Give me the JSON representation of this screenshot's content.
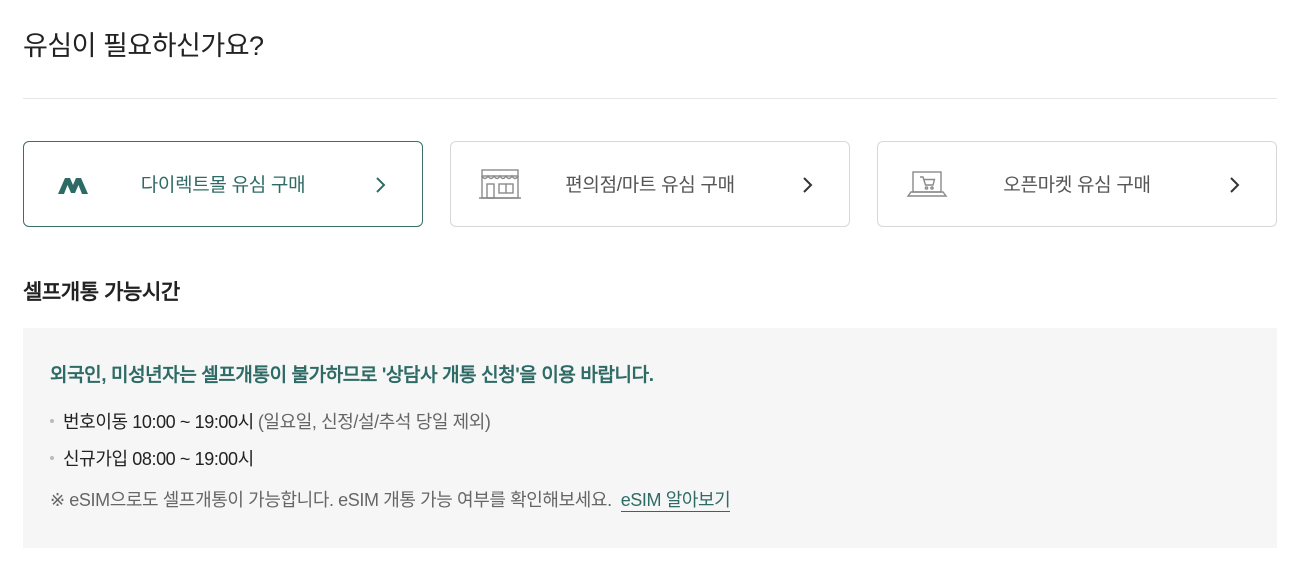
{
  "page_title": "유심이 필요하신가요?",
  "purchase_options": [
    {
      "label": "다이렉트몰 유심 구매",
      "icon": "m-logo-icon",
      "active": true
    },
    {
      "label": "편의점/마트 유심 구매",
      "icon": "store-icon",
      "active": false
    },
    {
      "label": "오픈마켓 유심 구매",
      "icon": "laptop-cart-icon",
      "active": false
    }
  ],
  "self_activation": {
    "title": "셀프개통 가능시간",
    "notice": "외국인, 미성년자는 셀프개통이 불가하므로 '상담사 개통 신청'을 이용 바랍니다.",
    "hours": [
      {
        "label": "번호이동 10:00 ~ 19:00시",
        "sub": "(일요일, 신정/설/추석 당일 제외)"
      },
      {
        "label": "신규가입 08:00 ~ 19:00시",
        "sub": ""
      }
    ],
    "esim_note": "※ eSIM으로도 셀프개통이 가능합니다. eSIM 개통 가능 여부를 확인해보세요.",
    "esim_link": "eSIM 알아보기"
  },
  "colors": {
    "accent": "#2f6b66",
    "active_border": "#3b6e6a",
    "box_bg": "#f6f6f6"
  }
}
